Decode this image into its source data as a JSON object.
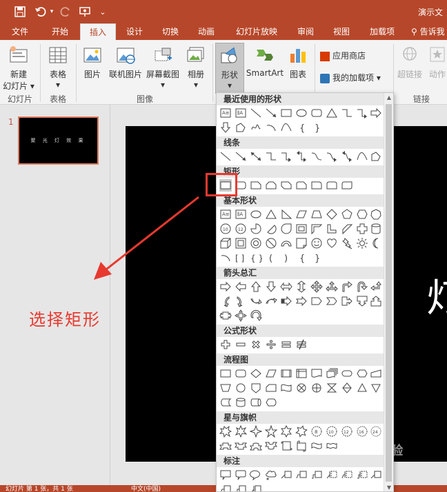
{
  "titlebar": {
    "doc_title": "演示文",
    "qa_save": "save-icon",
    "qa_undo": "undo-icon",
    "qa_redo": "redo-icon",
    "qa_present": "present-icon",
    "qa_more": "⌄"
  },
  "tabs": [
    {
      "label": "文件"
    },
    {
      "label": "开始"
    },
    {
      "label": "插入"
    },
    {
      "label": "设计"
    },
    {
      "label": "切换"
    },
    {
      "label": "动画"
    },
    {
      "label": "幻灯片放映"
    },
    {
      "label": "审阅"
    },
    {
      "label": "视图"
    },
    {
      "label": "加载项"
    },
    {
      "label": "告诉我"
    }
  ],
  "ribbon": {
    "new_slide": "新建\n幻灯片",
    "new_slide_l1": "新建",
    "new_slide_l2": "幻灯片 ▾",
    "table": "表格",
    "table_arrow": "▾",
    "picture": "图片",
    "online_picture": "联机图片",
    "screenshot": "屏幕截图",
    "screenshot_arrow": "▾",
    "album": "相册",
    "album_arrow": "▾",
    "shapes": "形状",
    "shapes_arrow": "▾",
    "smartart": "SmartArt",
    "chart": "图表",
    "store": "应用商店",
    "my_addins": "我的加载项",
    "my_addins_arrow": "▾",
    "hyperlink": "超链接",
    "action": "动作",
    "groups": {
      "slides": "幻灯片",
      "tables": "表格",
      "images": "图像",
      "links": "链接"
    }
  },
  "slides_panel": {
    "number": "1",
    "thumb_text": "聚 光 灯 效 果"
  },
  "annotation": "选择矩形",
  "canvas": {
    "big_char": "灯"
  },
  "shapes_menu": {
    "sections": [
      {
        "title": "最近使用的形状"
      },
      {
        "title": "线条"
      },
      {
        "title": "矩形"
      },
      {
        "title": "基本形状"
      },
      {
        "title": "箭头总汇"
      },
      {
        "title": "公式形状"
      },
      {
        "title": "流程图"
      },
      {
        "title": "星与旗帜"
      },
      {
        "title": "标注"
      }
    ]
  },
  "status": {
    "left": "幻灯片 第 1 张，共 1 张",
    "lang": "中文(中国)"
  },
  "watermark": "Bai 经验",
  "colors": {
    "accent": "#b7472a",
    "annotation": "#e8392f"
  }
}
